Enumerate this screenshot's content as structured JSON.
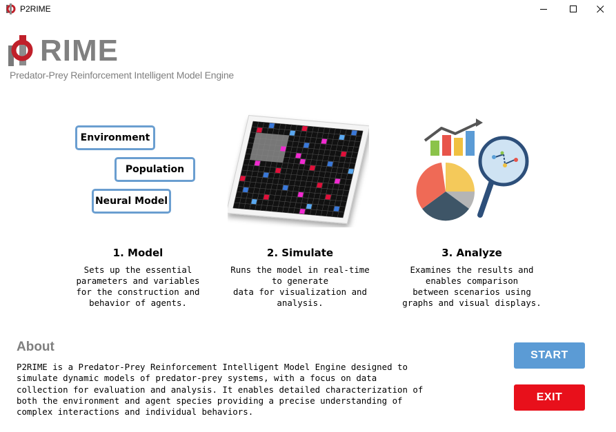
{
  "window": {
    "title": "P2RIME"
  },
  "logo": {
    "word": "RIME",
    "tagline": "Predator-Prey Reinforcement Intelligent  Model  Engine"
  },
  "model_boxes": {
    "environment": "Environment",
    "population": "Population",
    "neural_model": "Neural Model"
  },
  "steps": [
    {
      "title": "1. Model",
      "description": "Sets up the essential\nparameters and variables\nfor the construction and\nbehavior of agents."
    },
    {
      "title": "2. Simulate",
      "description": "Runs the model in real-time\nto generate\ndata for visualization and\nanalysis."
    },
    {
      "title": "3. Analyze",
      "description": "Examines the results and\nenables comparison\nbetween scenarios using\ngraphs and visual displays."
    }
  ],
  "about": {
    "title": "About",
    "text": "P2RIME is a Predator-Prey Reinforcement Intelligent Model Engine designed to simulate dynamic models of predator-prey systems, with a focus on data collection for evaluation and analysis. It enables detailed characterization of both the environment and agent species providing a precise understanding of complex interactions and individual behaviors."
  },
  "buttons": {
    "start": "START",
    "exit": "EXIT"
  },
  "colors": {
    "accent_blue": "#5b9bd5",
    "exit_red": "#e8101b",
    "box_border": "#6a9ed0",
    "logo_gray": "#808080",
    "logo_red": "#c0202a"
  }
}
